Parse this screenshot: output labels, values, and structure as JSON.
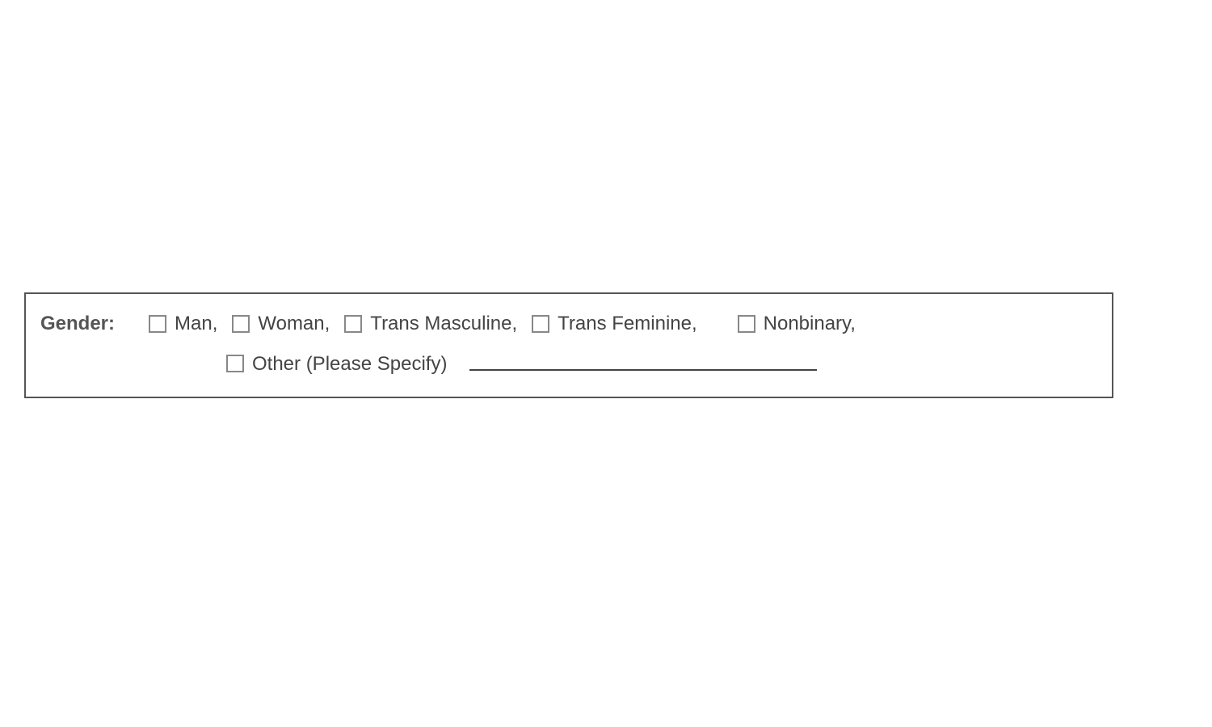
{
  "form": {
    "field_label": "Gender:",
    "options": [
      {
        "label": "Man,"
      },
      {
        "label": "Woman,"
      },
      {
        "label": "Trans Masculine,"
      },
      {
        "label": "Trans Feminine,"
      },
      {
        "label": "Nonbinary,"
      },
      {
        "label": "Other (Please Specify)"
      }
    ],
    "other_value": ""
  }
}
